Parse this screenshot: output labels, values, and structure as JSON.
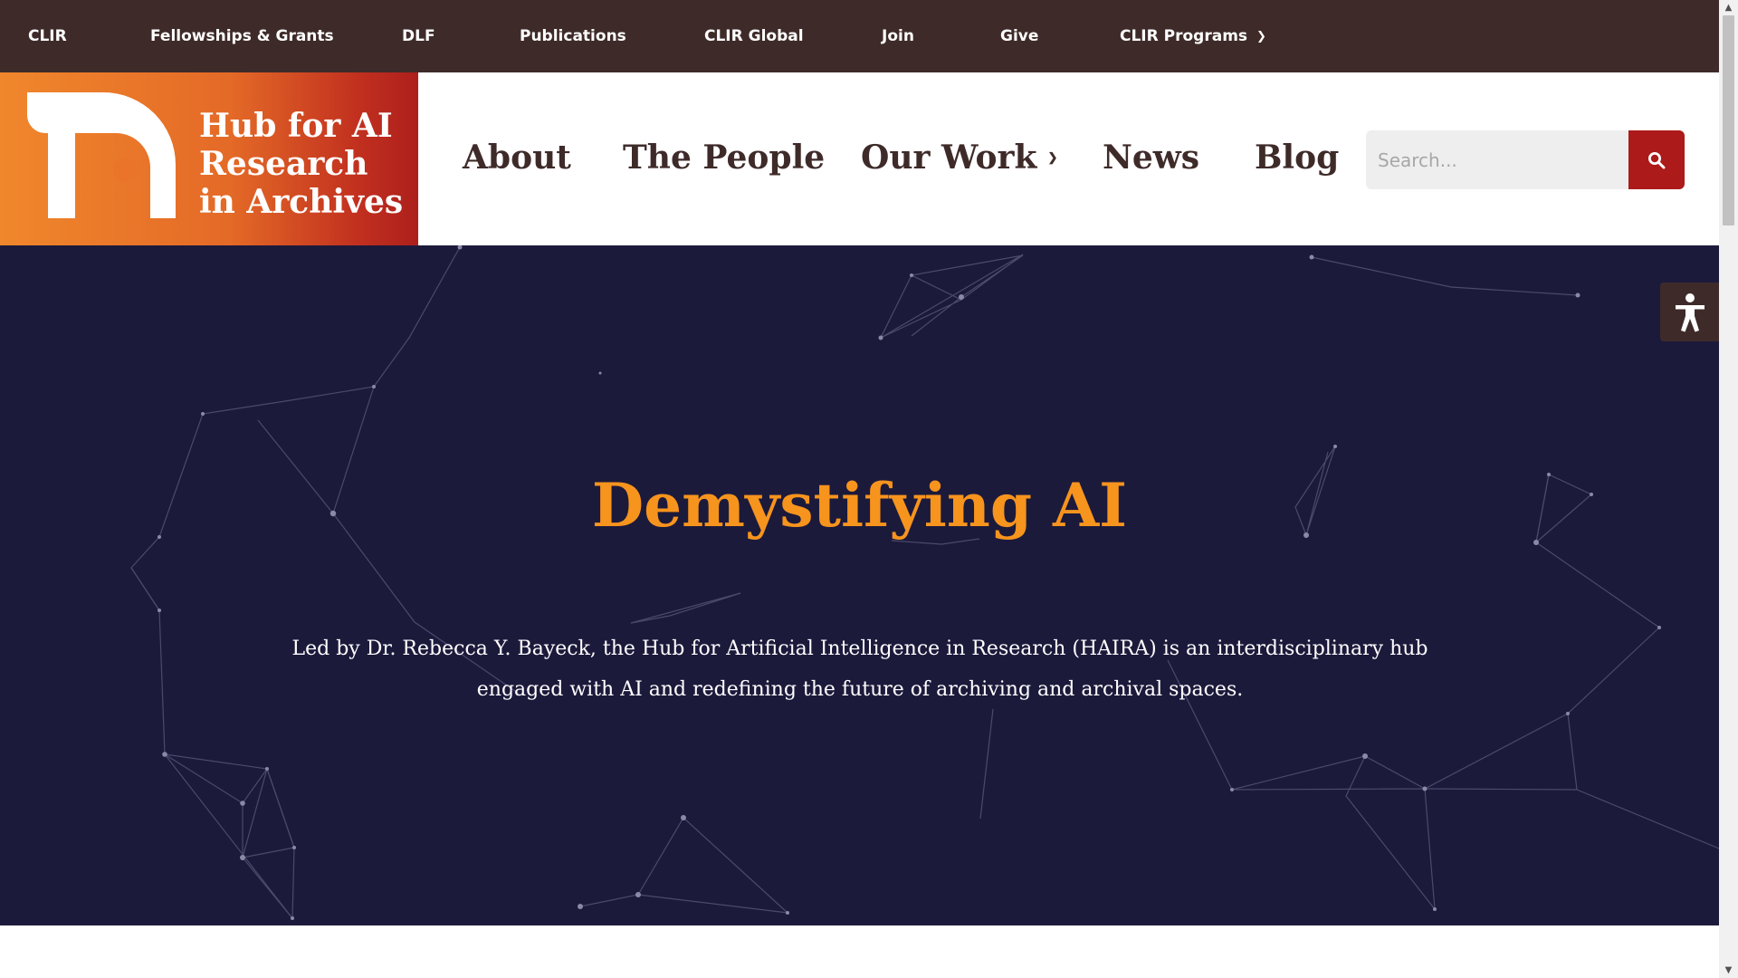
{
  "topbar": {
    "links": [
      "CLIR",
      "Fellowships & Grants",
      "DLF",
      "Publications",
      "CLIR Global",
      "Join",
      "Give",
      "CLIR Programs"
    ]
  },
  "logo": {
    "line1": "Hub for AI",
    "line2": "Research",
    "line3": "in Archives"
  },
  "mainnav": {
    "about": "About",
    "people": "The People",
    "work": "Our Work",
    "news": "News",
    "blog": "Blog"
  },
  "search": {
    "placeholder": "Search..."
  },
  "hero": {
    "title": "Demystifying AI",
    "text": "Led by Dr. Rebecca Y. Bayeck, the Hub for Artificial Intelligence in Research (HAIRA) is an interdisciplinary hub engaged with AI and redefining the future of archiving and archival spaces."
  },
  "colors": {
    "topbar": "#3e2b29",
    "hero_bg": "#1c1a3b",
    "accent_orange": "#f7941d",
    "search_button": "#ac1a1a"
  },
  "icons": {
    "search": "search-icon",
    "accessibility": "accessibility-icon",
    "chevron": "chevron-down-icon"
  }
}
